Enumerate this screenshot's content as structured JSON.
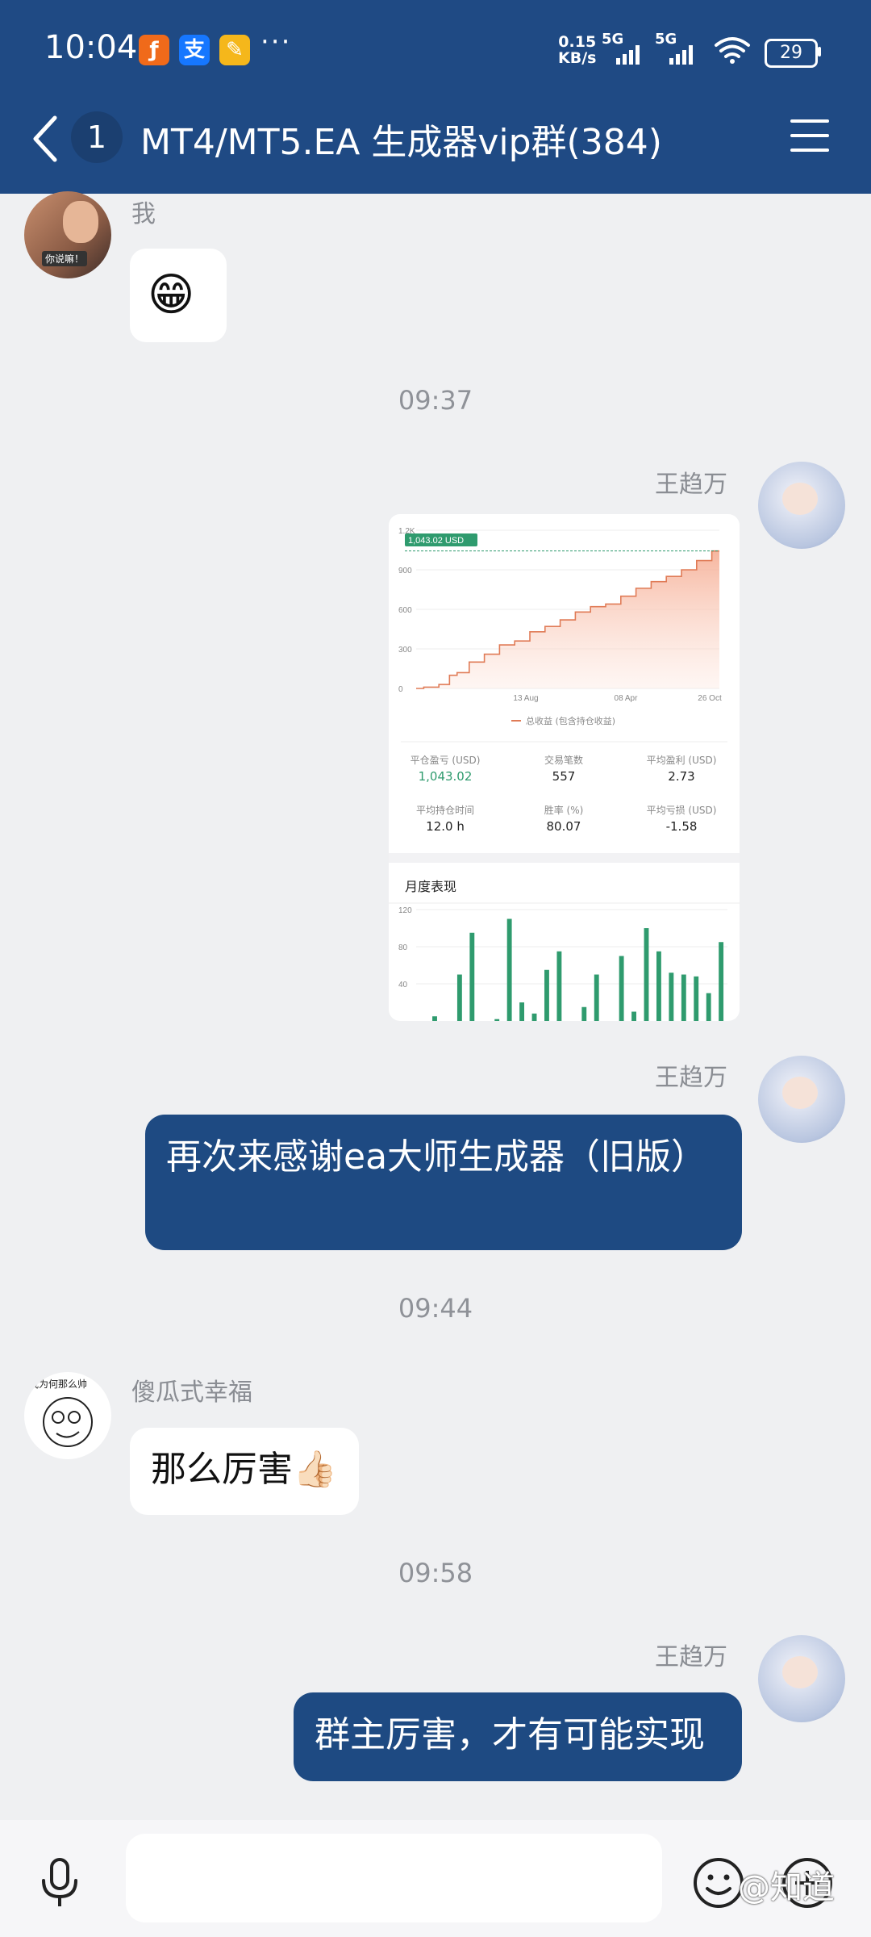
{
  "status": {
    "time": "10:04",
    "app_icons": [
      "fliggy-icon",
      "alipay-icon",
      "notes-icon"
    ],
    "more": "···",
    "net_speed": "0.15",
    "net_unit": "KB/s",
    "signal1": "5G",
    "signal2": "5G",
    "battery": "29"
  },
  "header": {
    "unread": "1",
    "title": "MT4/MT5.EA 生成器vip群(384)"
  },
  "messages": {
    "m1": {
      "sender": "我",
      "emoji": "😁",
      "avatar_caption": "你说嘛！"
    },
    "t1": "09:37",
    "m2": {
      "sender": "王趋万"
    },
    "m3": {
      "sender": "王趋万",
      "text": "再次来感谢ea大师生成器（旧版）"
    },
    "t2": "09:44",
    "m4": {
      "sender": "傻瓜式幸福",
      "text": "那么厉害👍🏻",
      "avatar_caption": "我为何那么帅"
    },
    "t3": "09:58",
    "m5": {
      "sender": "王趋万",
      "text": "群主厉害，才有可能实现"
    }
  },
  "card": {
    "badge": "1,043.02 USD",
    "y_ticks": [
      "1.2K",
      "900",
      "600",
      "300",
      "0"
    ],
    "x_ticks": [
      "13 Aug",
      "08 Apr",
      "26 Oct"
    ],
    "legend": "总收益 (包含持仓收益)",
    "stats": [
      {
        "label": "平仓盈亏 (USD)",
        "value": "1,043.02"
      },
      {
        "label": "交易笔数",
        "value": "557"
      },
      {
        "label": "平均盈利 (USD)",
        "value": "2.73"
      },
      {
        "label": "平均持仓时间",
        "value": "12.0 h"
      },
      {
        "label": "胜率 (%)",
        "value": "80.07"
      },
      {
        "label": "平均亏损 (USD)",
        "value": "-1.58"
      }
    ],
    "monthly_title": "月度表现",
    "monthly_ticks": [
      "120",
      "80",
      "40"
    ]
  },
  "chart_data": [
    {
      "type": "area",
      "ylabel": "",
      "ylim": [
        0,
        1200
      ],
      "x": [
        0,
        0.05,
        0.1,
        0.12,
        0.15,
        0.2,
        0.25,
        0.3,
        0.35,
        0.4,
        0.45,
        0.5,
        0.55,
        0.6,
        0.65,
        0.7,
        0.75,
        0.8,
        0.85,
        0.9,
        0.95,
        1.0
      ],
      "series": [
        {
          "name": "总收益 (包含持仓收益)",
          "values": [
            0,
            10,
            30,
            100,
            120,
            200,
            260,
            330,
            360,
            430,
            470,
            520,
            580,
            620,
            640,
            700,
            760,
            810,
            850,
            900,
            970,
            1043
          ]
        }
      ],
      "color": "#e9896a"
    },
    {
      "type": "bar",
      "title": "月度表现",
      "ylim": [
        0,
        120
      ],
      "values": [
        0,
        5,
        0,
        50,
        95,
        0,
        2,
        110,
        20,
        8,
        55,
        75,
        0,
        15,
        50,
        0,
        70,
        10,
        100,
        75,
        52,
        50,
        48,
        30,
        85
      ],
      "color": "#2f9b6e"
    }
  ]
}
